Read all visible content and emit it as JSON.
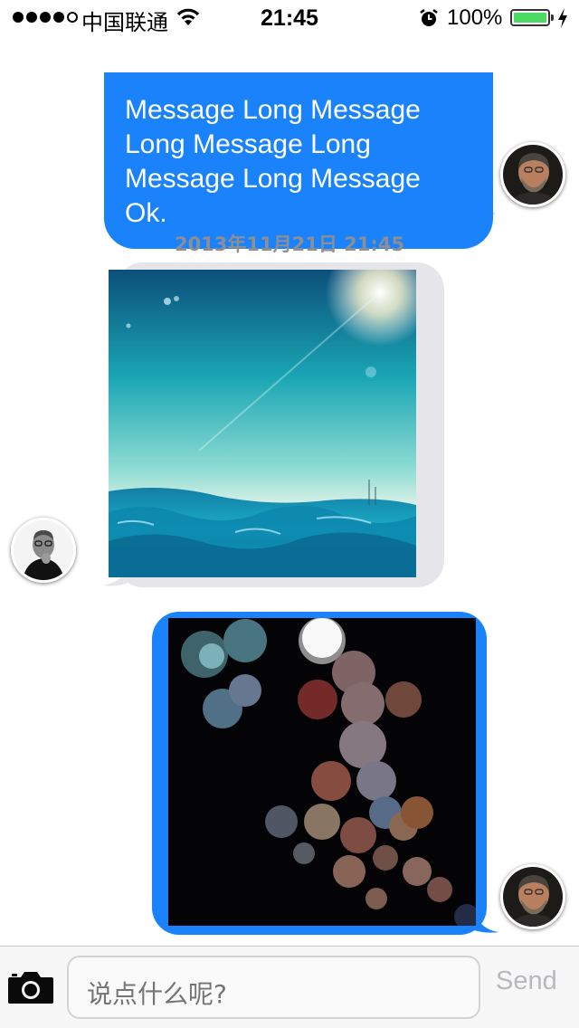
{
  "status_bar": {
    "carrier": "中国联通",
    "time": "21:45",
    "battery_percent": "100%",
    "battery_level": 1.0,
    "signal_bars_filled": 4,
    "signal_bars_total": 5
  },
  "messages": [
    {
      "type": "text",
      "direction": "outgoing",
      "lines": [
        "Message Long Message",
        "Long Message Long",
        "Message Long Message",
        "Ok."
      ]
    },
    {
      "type": "timestamp",
      "text": "2013年11月21日 21:45"
    },
    {
      "type": "image",
      "direction": "incoming",
      "image_description": "ocean-wave-photo",
      "sender": "steve-jobs"
    },
    {
      "type": "image",
      "direction": "outgoing",
      "image_description": "bokeh-lights-photo",
      "sender": "steve-wozniak"
    }
  ],
  "input": {
    "placeholder": "说点什么呢?",
    "send_label": "Send"
  },
  "colors": {
    "outgoing_bubble": "#1a82fb",
    "incoming_bubble": "#e5e5ea",
    "battery": "#4cd964",
    "timestamp": "#8e8e93"
  }
}
